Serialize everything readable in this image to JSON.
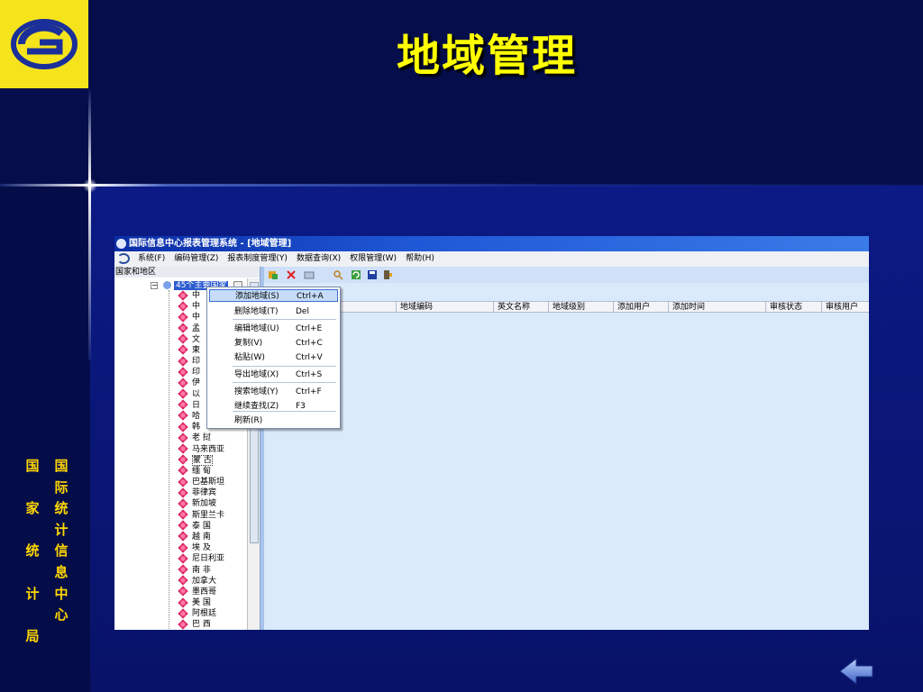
{
  "slide": {
    "title": "地域管理",
    "side_columns": [
      {
        "chars": [
          "国",
          "际",
          "统",
          "计",
          "信",
          "息",
          "中",
          "心"
        ]
      },
      {
        "chars": [
          "国",
          "",
          "家",
          "",
          "统",
          "",
          "计",
          "",
          "局"
        ]
      }
    ]
  },
  "window": {
    "title": "国际信息中心报表管理系统 - [地域管理]",
    "menu": [
      "系统(F)",
      "编码管理(Z)",
      "报表制度管理(Y)",
      "数据查询(X)",
      "权限管理(W)",
      "帮助(H)"
    ],
    "left_panel_header": "国家和地区",
    "tree_root": "45个主要国家",
    "tree_items": [
      "中",
      "中",
      "中",
      "孟",
      "文",
      "柬",
      "印",
      "印",
      "伊",
      "以",
      "日",
      "哈",
      "韩",
      "老 挝",
      "马来西亚",
      "蒙 古",
      "缅 甸",
      "巴基斯坦",
      "菲律宾",
      "新加坡",
      "斯里兰卡",
      "泰 国",
      "越 南",
      "埃 及",
      "尼日利亚",
      "南 非",
      "加拿大",
      "墨西哥",
      "美 国",
      "阿根廷",
      "巴 西"
    ],
    "selected_item": "蒙 古",
    "columns": [
      "地域编码",
      "英文名称",
      "地域级别",
      "添加用户",
      "添加时间",
      "审核状态",
      "审核用户"
    ],
    "context_menu": [
      {
        "label": "添加地域(S)",
        "shortcut": "Ctrl+A",
        "highlighted": true
      },
      {
        "label": "删除地域(T)",
        "shortcut": "Del"
      },
      {
        "label": "编辑地域(U)",
        "shortcut": "Ctrl+E"
      },
      {
        "label": "复制(V)",
        "shortcut": "Ctrl+C"
      },
      {
        "label": "粘贴(W)",
        "shortcut": "Ctrl+V"
      },
      {
        "label": "导出地域(X)",
        "shortcut": "Ctrl+S"
      },
      {
        "label": "搜索地域(Y)",
        "shortcut": "Ctrl+F"
      },
      {
        "label": "继续查找(Z)",
        "shortcut": "F3"
      },
      {
        "label": "刷新(R)",
        "shortcut": ""
      }
    ]
  },
  "colors": {
    "title": "#ffff00",
    "logo_bg": "#f5e41c",
    "side_text": "#ffd700",
    "accent": "#2a5bd0"
  },
  "icons": [
    "logo-icon",
    "app-icon",
    "add-icon",
    "delete-icon",
    "edit-icon",
    "search-icon",
    "refresh-icon",
    "save-icon",
    "exit-icon",
    "back-arrow-icon"
  ]
}
